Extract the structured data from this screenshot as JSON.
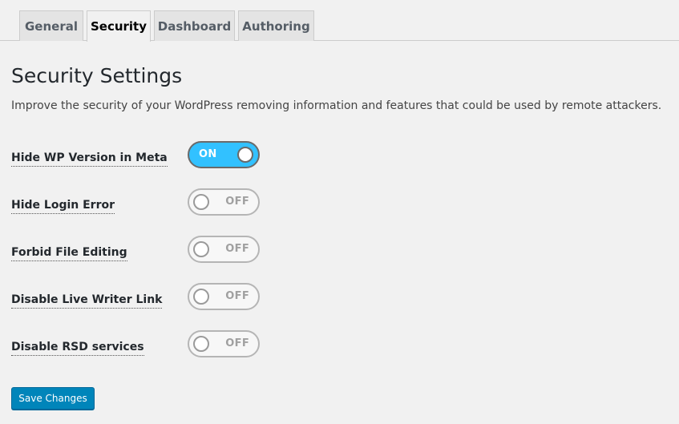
{
  "tabs": [
    {
      "label": "General"
    },
    {
      "label": "Security"
    },
    {
      "label": "Dashboard"
    },
    {
      "label": "Authoring"
    }
  ],
  "page": {
    "title": "Security Settings",
    "description": "Improve the security of your WordPress removing information and features that could be used by remote attackers."
  },
  "settings": [
    {
      "label": "Hide WP Version in Meta",
      "state": "ON"
    },
    {
      "label": "Hide Login Error",
      "state": "OFF"
    },
    {
      "label": "Forbid File Editing",
      "state": "OFF"
    },
    {
      "label": "Disable Live Writer Link",
      "state": "OFF"
    },
    {
      "label": "Disable RSD services",
      "state": "OFF"
    }
  ],
  "actions": {
    "save_label": "Save Changes"
  },
  "colors": {
    "toggle_on": "#32c1ff",
    "primary_button": "#0085ba",
    "background": "#f1f1f1"
  }
}
